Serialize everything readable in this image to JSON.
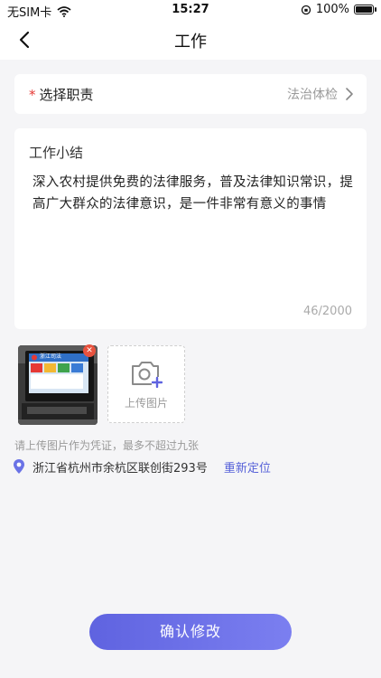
{
  "statusbar": {
    "carrier": "无SIM卡",
    "time": "15:27",
    "battery": "100%",
    "battery_level": 1.0,
    "icons": [
      "wifi-icon",
      "orientation-lock-icon",
      "battery-icon"
    ]
  },
  "header": {
    "title": "工作",
    "back_icon": "chevron-left-icon"
  },
  "duty": {
    "required_mark": "*",
    "label": "选择职责",
    "value": "法治体检",
    "chevron_icon": "chevron-right-icon"
  },
  "summary": {
    "label": "工作小结",
    "text": "深入农村提供免费的法律服务，普及法律知识常识，提高广大群众的法律意识，是一件非常有意义的事情",
    "count": "46/2000"
  },
  "photos": {
    "thumbnail_screen_text": "浙江司法",
    "remove_icon": "close-icon",
    "upload_icon": "camera-add-icon",
    "upload_label": "上传图片",
    "hint": "请上传图片作为凭证，最多不超过九张"
  },
  "location": {
    "icon": "location-pin-icon",
    "address": "浙江省杭州市余杭区联创街293号",
    "relocate_label": "重新定位"
  },
  "submit": {
    "label": "确认修改"
  },
  "colors": {
    "accent": "#5f63e0",
    "required": "#e53935",
    "background": "#f5f5f7",
    "link": "#5560d8"
  }
}
